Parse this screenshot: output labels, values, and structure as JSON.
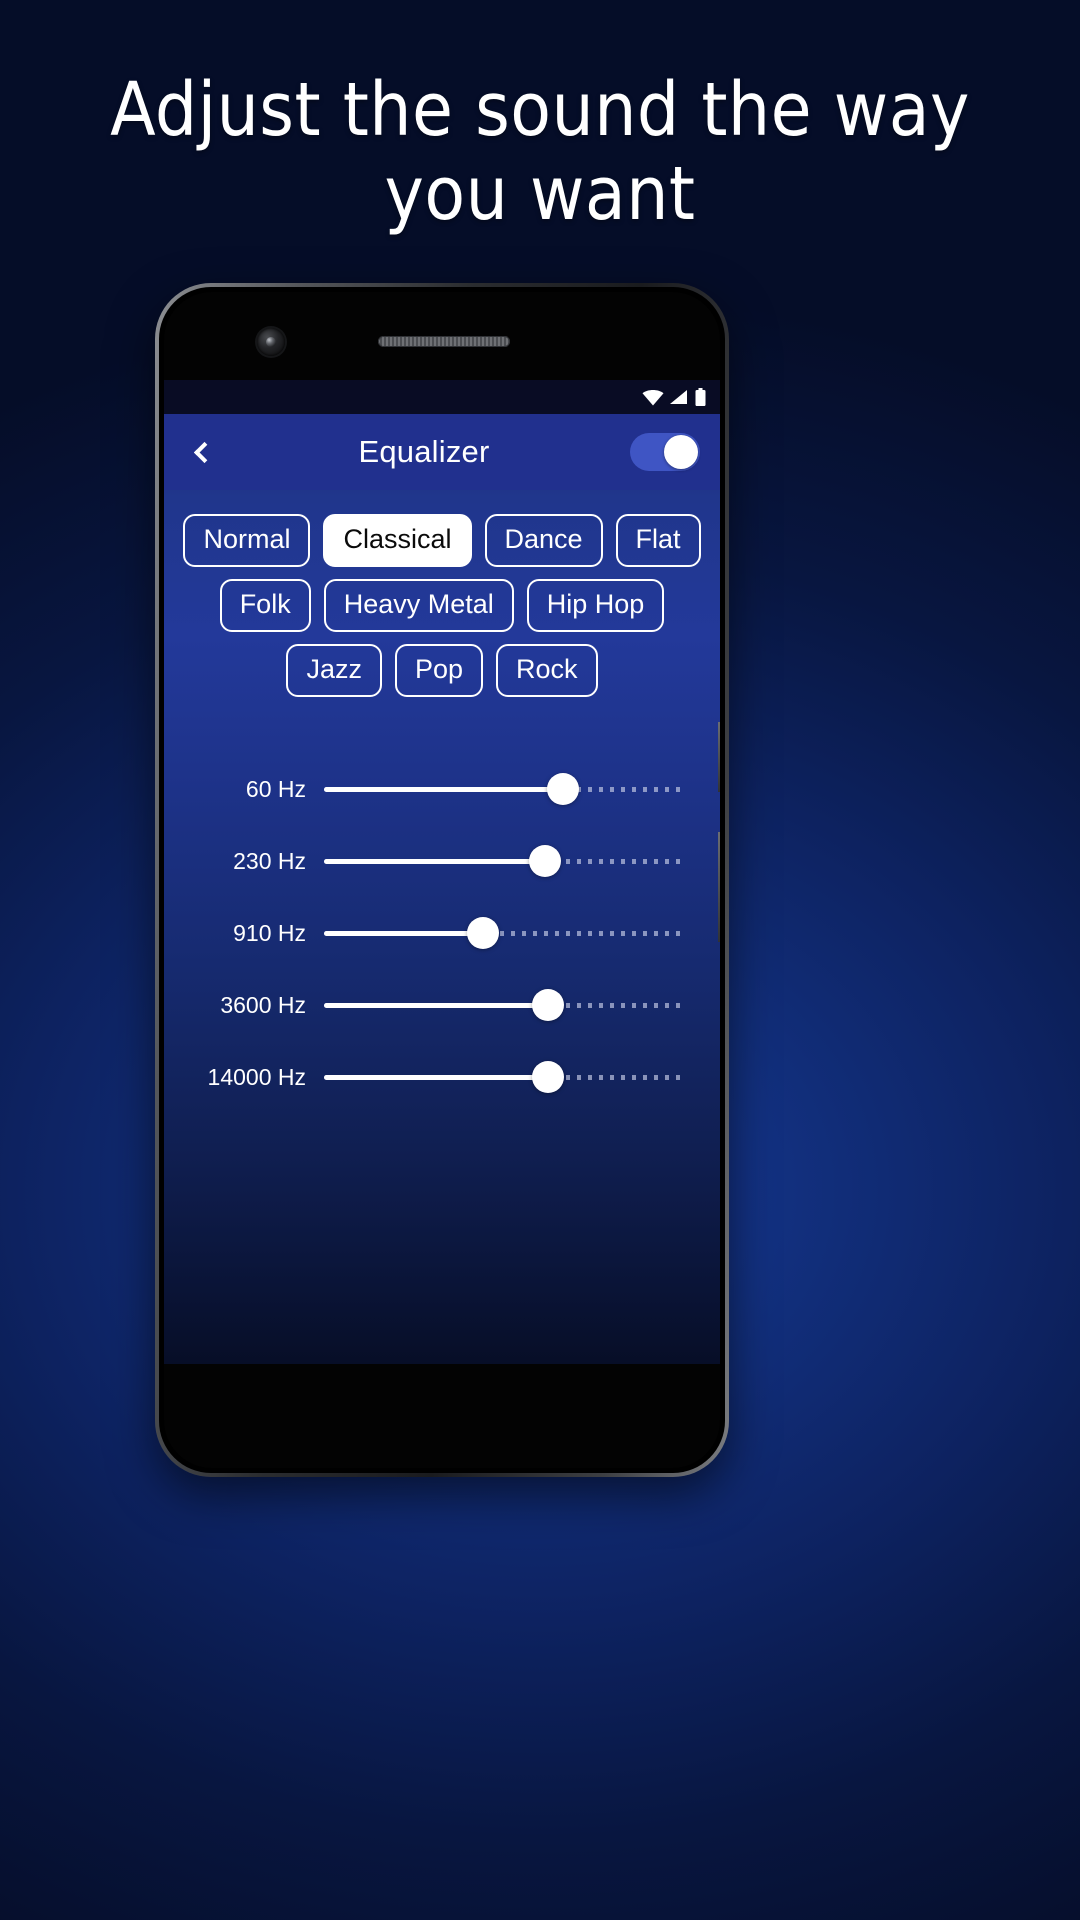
{
  "headline": "Adjust the sound the way you want",
  "phone": {
    "camera_icon": "front-camera",
    "speaker_icon": "earpiece-speaker"
  },
  "statusbar": {
    "icons": [
      {
        "name": "wifi-icon",
        "label": "wifi"
      },
      {
        "name": "signal-icon",
        "label": "cellular-signal"
      },
      {
        "name": "battery-icon",
        "label": "battery"
      }
    ]
  },
  "appbar": {
    "back_icon": "chevron-left-icon",
    "title": "Equalizer",
    "toggle": {
      "name": "equalizer-power-toggle",
      "state": "on"
    }
  },
  "presets": {
    "selected": "Classical",
    "rows": [
      [
        "Normal",
        "Classical",
        "Dance",
        "Flat"
      ],
      [
        "Folk",
        "Heavy Metal",
        "Hip Hop"
      ],
      [
        "Jazz",
        "Pop",
        "Rock"
      ]
    ]
  },
  "sliders": [
    {
      "label": "60 Hz",
      "value": 66
    },
    {
      "label": "230 Hz",
      "value": 61
    },
    {
      "label": "910 Hz",
      "value": 44
    },
    {
      "label": "3600 Hz",
      "value": 62
    },
    {
      "label": "14000 Hz",
      "value": 62
    }
  ],
  "colors": {
    "appbar": "#21308e",
    "background_top": "#0a0d26",
    "accent_white": "#ffffff",
    "toggle_track": "#3f55c4"
  }
}
